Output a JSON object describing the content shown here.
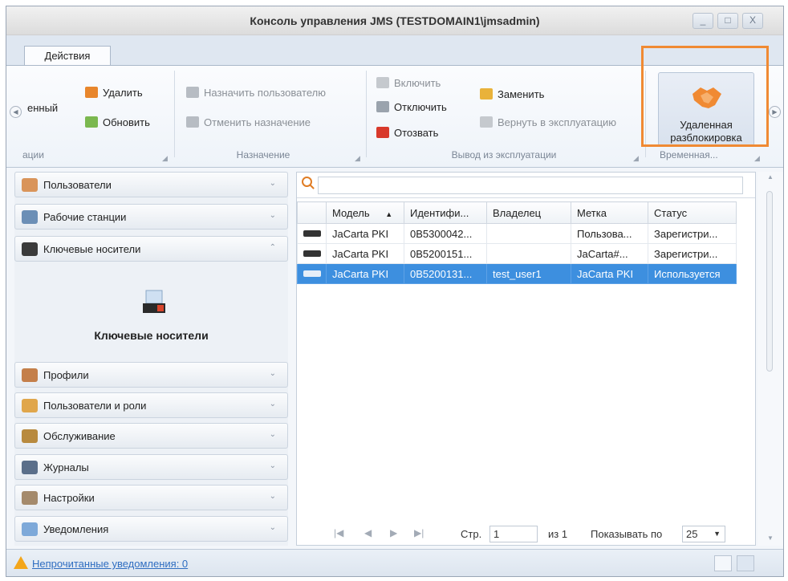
{
  "window": {
    "title": "Консоль управления JMS (TESTDOMAIN1\\jmsadmin)",
    "controls": [
      "_",
      "□",
      "X"
    ]
  },
  "tabs": [
    "Действия"
  ],
  "ribbon": {
    "group_partial": {
      "label": "ации",
      "button_partial": "енный",
      "delete": "Удалить",
      "refresh": "Обновить"
    },
    "group_assign": {
      "label": "Назначение",
      "assign": "Назначить пользователю",
      "unassign": "Отменить назначение"
    },
    "group_decommission": {
      "label": "Вывод из эксплуатации",
      "enable": "Включить",
      "disable": "Отключить",
      "revoke": "Отозвать",
      "replace": "Заменить",
      "return": "Вернуть в эксплуатацию"
    },
    "group_temp": {
      "label": "Временная...",
      "remote_unblock_line1": "Удаленная",
      "remote_unblock_line2": "разблокировка"
    }
  },
  "sidebar": {
    "items_top": [
      {
        "label": "Пользователи",
        "icon": "users-icon",
        "chev": "⌄"
      },
      {
        "label": "Рабочие станции",
        "icon": "workstations-icon",
        "chev": "⌄"
      },
      {
        "label": "Ключевые носители",
        "icon": "key-token-icon",
        "chev": "⌃"
      }
    ],
    "panel_title": "Ключевые носители",
    "items_bottom": [
      {
        "label": "Профили",
        "icon": "profiles-icon",
        "chev": "⌄"
      },
      {
        "label": "Пользователи и роли",
        "icon": "roles-icon",
        "chev": "⌄"
      },
      {
        "label": "Обслуживание",
        "icon": "maintenance-icon",
        "chev": "⌄"
      },
      {
        "label": "Журналы",
        "icon": "logs-icon",
        "chev": "⌄"
      },
      {
        "label": "Настройки",
        "icon": "settings-icon",
        "chev": "⌄"
      },
      {
        "label": "Уведомления",
        "icon": "notifications-icon",
        "chev": "⌄"
      }
    ]
  },
  "grid": {
    "columns": [
      "Модель",
      "Идентифи...",
      "Владелец",
      "Метка",
      "Статус"
    ],
    "sort_indicator": "▲",
    "rows": [
      {
        "model": "JaCarta PKI",
        "id": "0B5300042...",
        "owner": "",
        "label": "Пользова...",
        "status": "Зарегистри...",
        "selected": false
      },
      {
        "model": "JaCarta PKI",
        "id": "0B5200151...",
        "owner": "",
        "label": "JaCarta#...",
        "status": "Зарегистри...",
        "selected": false
      },
      {
        "model": "JaCarta PKI",
        "id": "0B5200131...",
        "owner": "test_user1",
        "label": "JaCarta PKI",
        "status": "Используется",
        "selected": true
      }
    ]
  },
  "pager": {
    "page_label": "Стр.",
    "page_value": "1",
    "of_label": "из 1",
    "show_label": "Показывать по",
    "page_size": "25",
    "size_arrow": "▼"
  },
  "statusbar": {
    "notifications": "Непрочитанные уведомления: 0"
  },
  "colors": {
    "accent": "#f08a33",
    "selection": "#3d8fdf",
    "link": "#2f6ec1"
  }
}
